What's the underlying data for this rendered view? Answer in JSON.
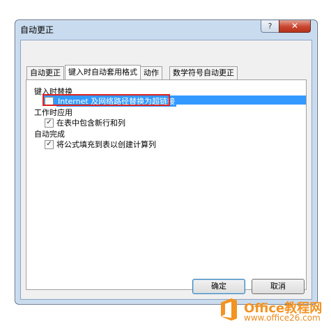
{
  "window": {
    "title": "自动更正",
    "help_label": "?",
    "close_label": "✕"
  },
  "tabs": [
    {
      "label": "自动更正",
      "active": false
    },
    {
      "label": "键入时自动套用格式",
      "active": true
    },
    {
      "label": "动作",
      "active": false
    },
    {
      "label": "数学符号自动更正",
      "active": false
    }
  ],
  "sections": {
    "replace_heading": "键入时替换",
    "apply_heading": "工作时应用",
    "complete_heading": "自动完成"
  },
  "options": {
    "internet_hyperlink": {
      "label": "Internet 及网络路径替换为超链接",
      "checked": false,
      "selected": true
    },
    "include_rows_cols": {
      "label": "在表中包含新行和列",
      "checked": true
    },
    "fill_formulas": {
      "label": "将公式填充到表以创建计算列",
      "checked": true
    }
  },
  "buttons": {
    "ok": "确定",
    "cancel": "取消"
  },
  "watermark": {
    "brand": "Office教程网",
    "url": "www.office26.com"
  },
  "colors": {
    "selection": "#3399ff",
    "highlight_border": "#e0201b",
    "brand_orange": "#f39322"
  }
}
